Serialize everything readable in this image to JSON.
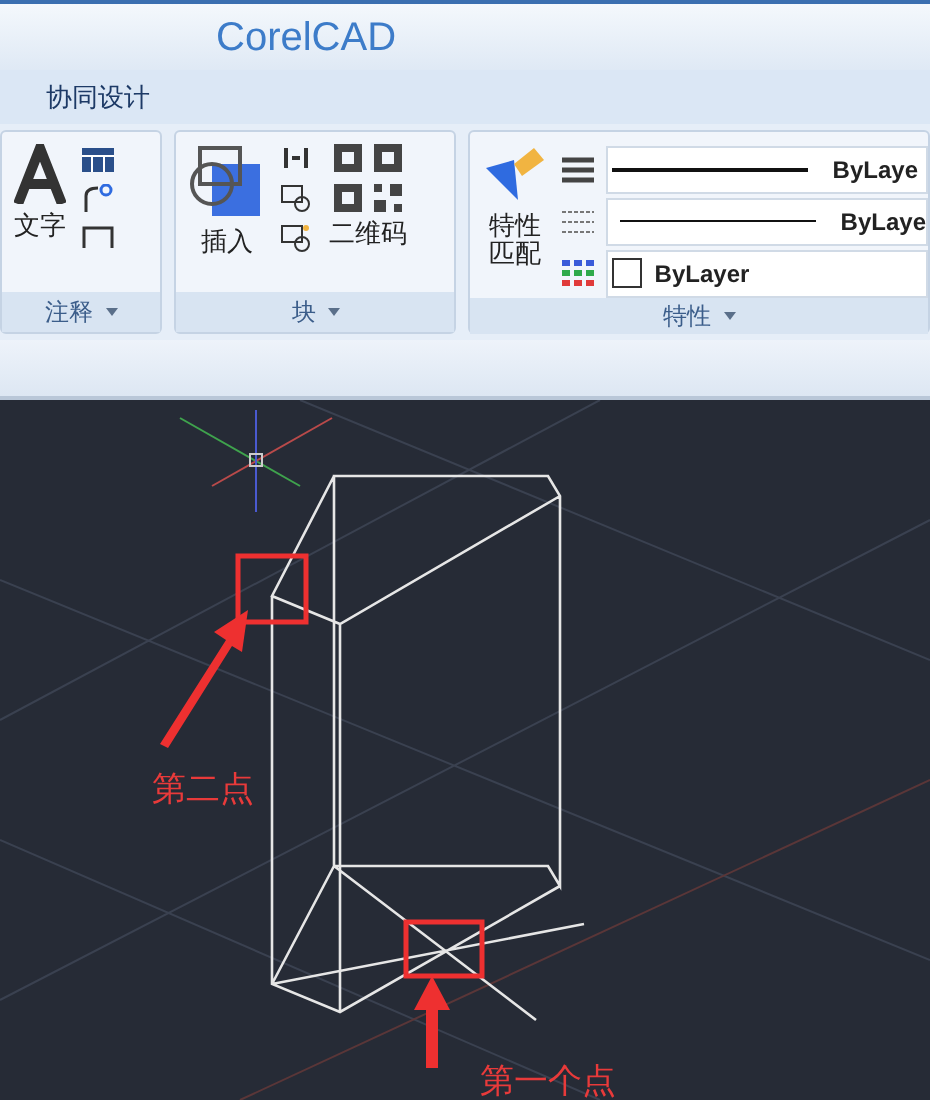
{
  "window": {
    "title": "CorelCAD"
  },
  "menu_tabs": [
    {
      "label": "协同设计",
      "selected": true
    }
  ],
  "ribbon": {
    "groups": [
      {
        "label": "注释",
        "buttons": [
          {
            "label": "文字",
            "kind": "text"
          }
        ]
      },
      {
        "label": "块",
        "buttons": [
          {
            "label": "插入",
            "kind": "insert"
          },
          {
            "label": "二维码",
            "kind": "qrcode"
          }
        ]
      },
      {
        "label": "特性",
        "buttons": [
          {
            "label": "特性匹配",
            "kind": "match"
          }
        ],
        "properties": [
          {
            "kind": "lineweight",
            "value": "ByLaye"
          },
          {
            "kind": "linetype",
            "value": "ByLaye"
          },
          {
            "kind": "color",
            "value": "ByLayer"
          }
        ]
      }
    ]
  },
  "annotations": [
    {
      "label": "第二点"
    },
    {
      "label": "第一个点"
    }
  ]
}
